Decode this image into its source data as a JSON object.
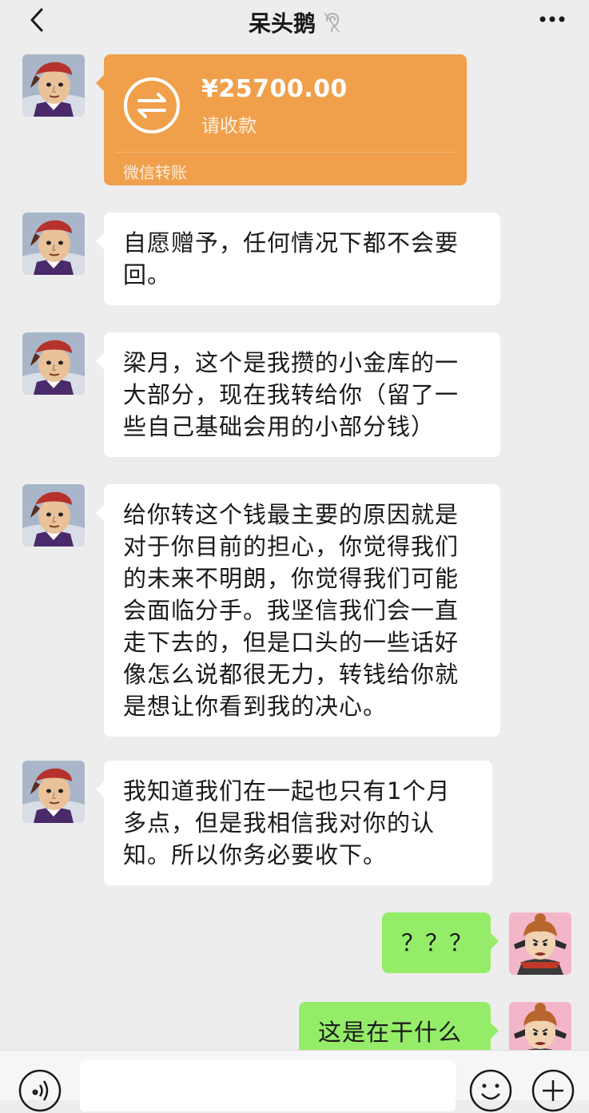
{
  "header": {
    "title": "呆头鹅",
    "back_icon": "chevron-left-icon",
    "more_icon": "more-dots-icon",
    "status_icon": "ear-icon"
  },
  "messages": [
    {
      "type": "transfer",
      "side": "left",
      "amount": "¥25700.00",
      "note": "请收款",
      "footer": "微信转账",
      "color": "#f0a04b"
    },
    {
      "type": "text",
      "side": "left",
      "text": "自愿赠予，任何情况下都不会要回。"
    },
    {
      "type": "text",
      "side": "left",
      "text": "梁月，这个是我攒的小金库的一大部分，现在我转给你（留了一些自己基础会用的小部分钱）"
    },
    {
      "type": "text",
      "side": "left",
      "text": "给你转这个钱最主要的原因就是对于你目前的担心，你觉得我们的未来不明朗，你觉得我们可能会面临分手。我坚信我们会一直走下去的，但是口头的一些话好像怎么说都很无力，转钱给你就是想让你看到我的决心。"
    },
    {
      "type": "text",
      "side": "left",
      "text": "我知道我们在一起也只有1个月多点，但是我相信我对你的认知。所以你务必要收下。"
    },
    {
      "type": "text",
      "side": "right",
      "text": "？？？"
    },
    {
      "type": "text",
      "side": "right",
      "text": "这是在干什么"
    }
  ],
  "input_bar": {
    "voice_icon": "voice-icon",
    "emoji_icon": "emoji-icon",
    "plus_icon": "plus-icon",
    "input_value": ""
  },
  "colors": {
    "background": "#ededed",
    "bubble_left": "#ffffff",
    "bubble_right": "#95ec69",
    "transfer": "#f0a04b"
  }
}
